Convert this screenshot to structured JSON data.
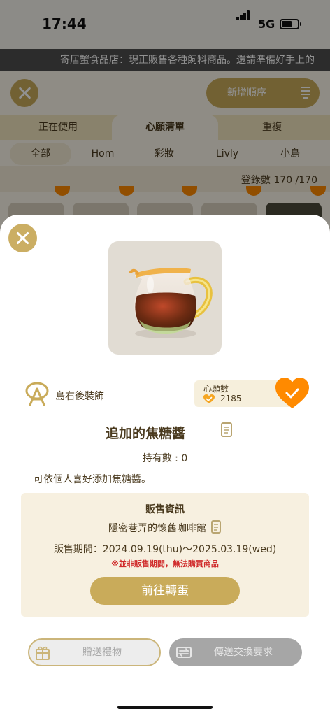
{
  "status_bar": {
    "time": "17:44",
    "network": "5G"
  },
  "ticker": {
    "text": "寄居蟹食品店：現正販售各種飼料商品。還請準備好手上的"
  },
  "toolbar": {
    "add_order_label": "新增順序"
  },
  "main_tabs": [
    {
      "label": "正在使用"
    },
    {
      "label": "心願清單"
    },
    {
      "label": "重複"
    }
  ],
  "sub_tabs": [
    {
      "label": "全部"
    },
    {
      "label": "Hom"
    },
    {
      "label": "彩妝"
    },
    {
      "label": "Livly"
    },
    {
      "label": "小島"
    }
  ],
  "register": {
    "label": "登錄數",
    "value": "170 /170"
  },
  "modal": {
    "category": "島右後裝飾",
    "wishlist_title": "心願數",
    "wishlist_count": "2185",
    "item_name": "追加的焦糖醬",
    "owned": "持有數 : 0",
    "description": "可依個人喜好添加焦糖醬。",
    "sale": {
      "title": "販售資訊",
      "shop": "隱密巷弄的懷舊咖啡館",
      "period": "販售期間：2024.09.19(thu)〜2025.03.19(wed)",
      "warning": "※並非販售期間，無法購買商品",
      "goto_label": "前往轉蛋"
    },
    "gift_label": "贈送禮物",
    "trade_label": "傳送交換要求"
  },
  "colors": {
    "gold": "#c9ab5a",
    "heart_orange": "#ff8a00",
    "warning_red": "#d02b2b",
    "text_brown": "#4a3a1e"
  }
}
